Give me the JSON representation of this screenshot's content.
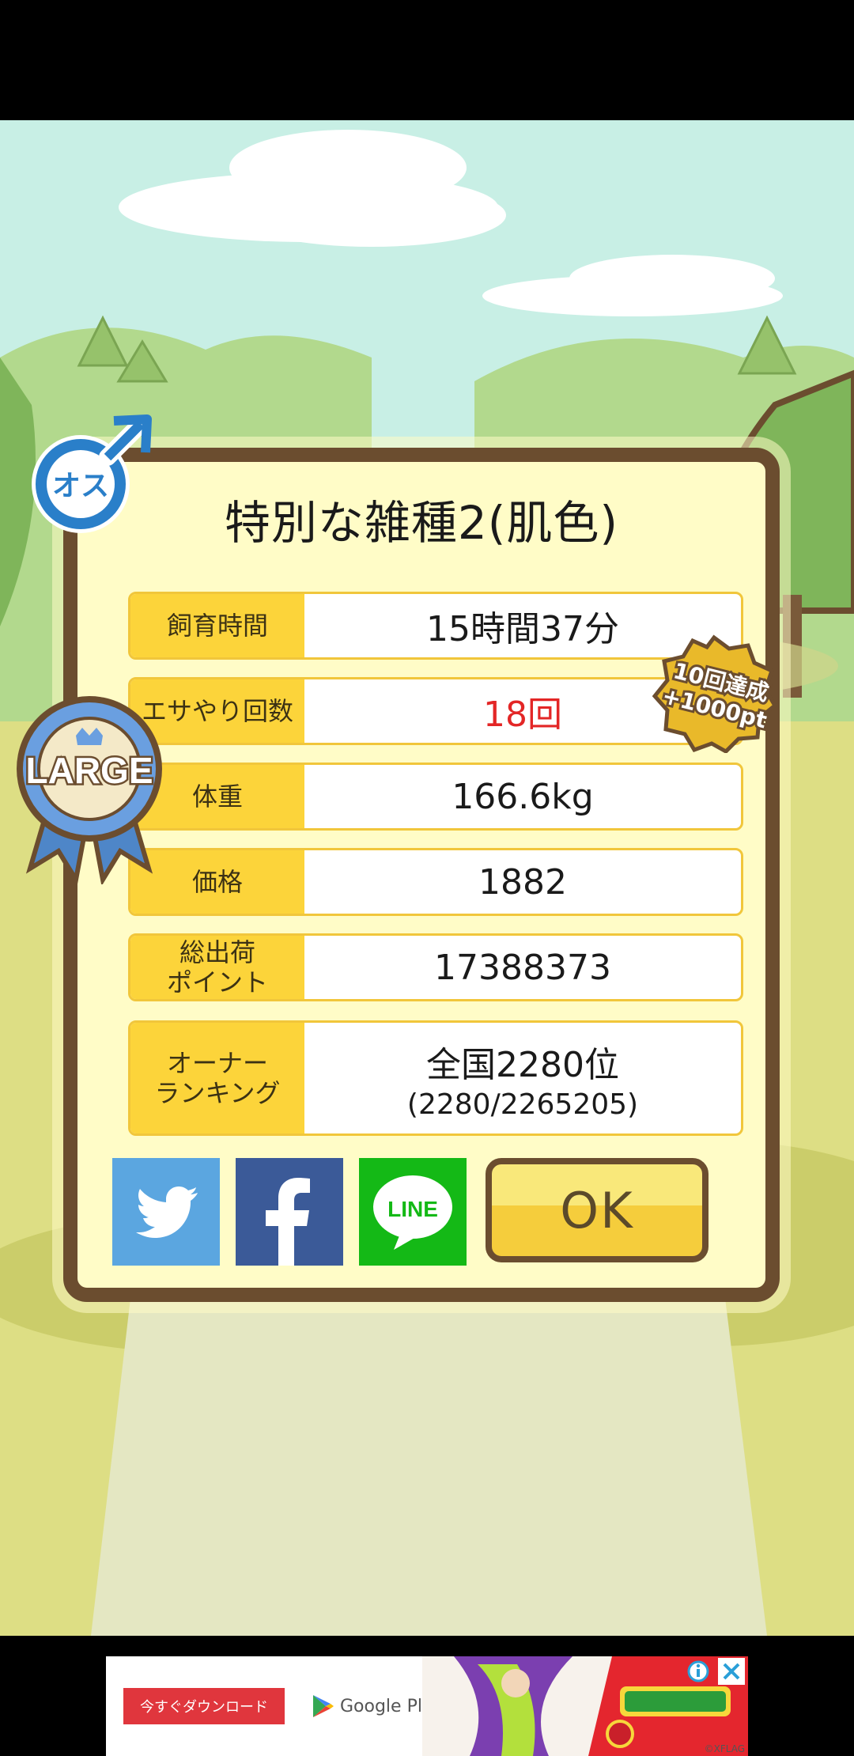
{
  "dialog": {
    "title": "特別な雑種2(肌色)",
    "rows": [
      {
        "label": "飼育時間",
        "value": "15時間37分"
      },
      {
        "label": "エサやり回数",
        "value": "18回"
      },
      {
        "label": "体重",
        "value": "166.6kg"
      },
      {
        "label": "価格",
        "value": "1882"
      },
      {
        "label": "総出荷\nポイント",
        "value": "17388373"
      },
      {
        "label": "オーナー\nランキング",
        "value": "全国2280位",
        "sub": "(2280/2265205)"
      }
    ],
    "ok_label": "OK"
  },
  "badges": {
    "gender": "オス",
    "size": "LARGE",
    "achievement_line1": "10回達成",
    "achievement_line2": "+1000pt"
  },
  "share": {
    "line_label": "LINE"
  },
  "ad": {
    "cta_label": "今すぐダウンロード",
    "store_label": "Google Play",
    "copyright": "©XFLAG"
  },
  "colors": {
    "panel_bg": "#fffcc7",
    "panel_border": "#6b4d2f",
    "label_bg": "#fcd43a",
    "highlight_value": "#e32626",
    "twitter": "#5ba6e0",
    "facebook": "#3b5a98",
    "line": "#14b916"
  }
}
